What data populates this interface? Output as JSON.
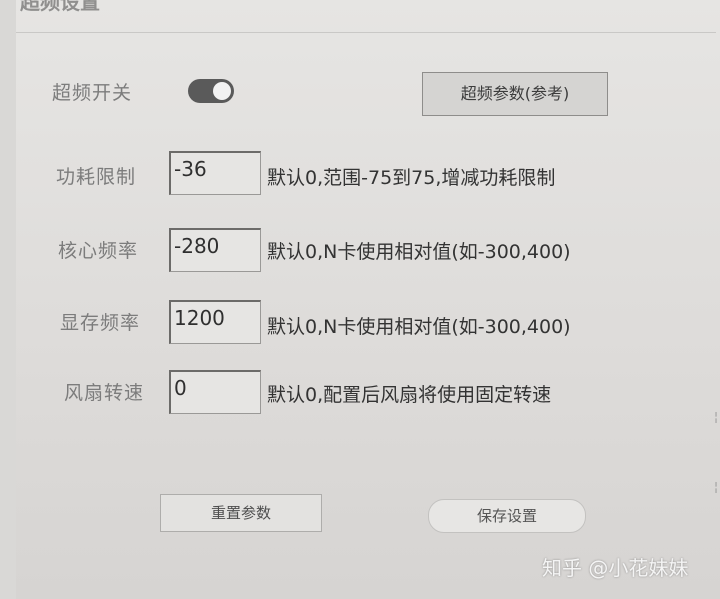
{
  "window": {
    "title": "超频设置"
  },
  "overclock": {
    "toggle_label": "超频开关",
    "toggle_on": true,
    "reference_button": "超频参数(参考)"
  },
  "fields": [
    {
      "label": "功耗限制",
      "value": "-36",
      "hint": "默认0,范围-75到75,增减功耗限制"
    },
    {
      "label": "核心频率",
      "value": "-280",
      "hint": "默认0,N卡使用相对值(如-300,400)"
    },
    {
      "label": "显存频率",
      "value": "1200",
      "hint": "默认0,N卡使用相对值(如-300,400)"
    },
    {
      "label": "风扇转速",
      "value": "0",
      "hint": "默认0,配置后风扇将使用固定转速"
    }
  ],
  "footer": {
    "reset_button": "重置参数",
    "save_button": "保存设置"
  },
  "watermark": "知乎 @小花妹妹"
}
